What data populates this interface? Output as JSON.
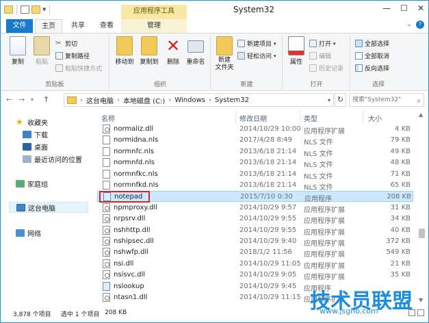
{
  "window": {
    "title": "System32"
  },
  "ribbon_tabs": {
    "file": "文件",
    "home": "主页",
    "share": "共享",
    "view": "查看",
    "context_group": "应用程序工具",
    "manage": "管理"
  },
  "ribbon": {
    "clipboard": {
      "label": "剪贴板",
      "copy": "复制",
      "paste": "粘贴",
      "cut": "剪切",
      "copy_path": "复制路径",
      "paste_shortcut": "粘贴快捷方式"
    },
    "organize": {
      "label": "组织",
      "move_to": "移动到",
      "copy_to": "复制到",
      "delete": "删除",
      "rename": "重命名"
    },
    "new": {
      "label": "新建",
      "new_folder": "新建\n文件夹",
      "new_item": "新建项目",
      "easy_access": "轻松访问"
    },
    "open": {
      "label": "打开",
      "properties": "属性",
      "open": "打开",
      "edit": "编辑",
      "history": "历史记录"
    },
    "select": {
      "label": "选择",
      "select_all": "全部选择",
      "select_none": "全部取消",
      "invert": "反向选择"
    }
  },
  "address": {
    "path": [
      "这台电脑",
      "本地磁盘 (C:)",
      "Windows",
      "System32"
    ],
    "search_placeholder": "搜索\"System32\""
  },
  "nav_pane": {
    "favorites": "收藏夹",
    "downloads": "下载",
    "desktop": "桌面",
    "recent": "最近访问的位置",
    "homegroup": "家庭组",
    "this_pc": "这台电脑",
    "network": "网络"
  },
  "columns": {
    "name": "名称",
    "date": "修改日期",
    "type": "类型",
    "size": "大小"
  },
  "files": [
    {
      "name": "normaliz.dll",
      "date": "2014/10/29 10:00",
      "type": "应用程序扩展",
      "size": "4 KB",
      "kind": "dll"
    },
    {
      "name": "normidna.nls",
      "date": "2017/4/28 8:49",
      "type": "NLS 文件",
      "size": "79 KB",
      "kind": "file"
    },
    {
      "name": "normnfc.nls",
      "date": "2013/6/18 21:14",
      "type": "NLS 文件",
      "size": "49 KB",
      "kind": "file"
    },
    {
      "name": "normnfd.nls",
      "date": "2013/6/18 21:14",
      "type": "NLS 文件",
      "size": "48 KB",
      "kind": "file"
    },
    {
      "name": "normnfkc.nls",
      "date": "2013/6/18 21:14",
      "type": "NLS 文件",
      "size": "71 KB",
      "kind": "file"
    },
    {
      "name": "normnfkd.nls",
      "date": "2013/6/18 21:14",
      "type": "NLS 文件",
      "size": "65 KB",
      "kind": "file"
    },
    {
      "name": "notepad",
      "date": "2015/7/10 0:30",
      "type": "应用程序",
      "size": "208 KB",
      "kind": "exe"
    },
    {
      "name": "npmproxy.dll",
      "date": "2014/10/29 9:57",
      "type": "应用程序扩展",
      "size": "31 KB",
      "kind": "dll"
    },
    {
      "name": "nrpsrv.dll",
      "date": "2014/10/29 9:55",
      "type": "应用程序扩展",
      "size": "34 KB",
      "kind": "dll"
    },
    {
      "name": "nshhttp.dll",
      "date": "2014/10/29 9:55",
      "type": "应用程序扩展",
      "size": "40 KB",
      "kind": "dll"
    },
    {
      "name": "nshipsec.dll",
      "date": "2014/10/29 9:40",
      "type": "应用程序扩展",
      "size": "372 KB",
      "kind": "dll"
    },
    {
      "name": "nshwfp.dll",
      "date": "2018/1/2 11:56",
      "type": "应用程序扩展",
      "size": "549 KB",
      "kind": "dll"
    },
    {
      "name": "nsi.dll",
      "date": "2014/10/29 11:05",
      "type": "应用程序扩展",
      "size": "21 KB",
      "kind": "dll"
    },
    {
      "name": "nsisvc.dll",
      "date": "2014/10/29 9:05",
      "type": "应用程序扩展",
      "size": "35 KB",
      "kind": "dll"
    },
    {
      "name": "nslookup",
      "date": "2014/10/29 9:45",
      "type": "应用程序",
      "size": "",
      "kind": "exe"
    },
    {
      "name": "ntasn1.dll",
      "date": "2014/10/29 11:15",
      "type": "应用程序扩展",
      "size": "",
      "kind": "dll"
    }
  ],
  "selected_index": 6,
  "status": {
    "count": "3,878 个项目",
    "selection": "选中 1 个项目",
    "sel_size": "208 KB"
  },
  "watermark": {
    "brand": "技术员联盟",
    "url": "www.jsgho.com"
  }
}
